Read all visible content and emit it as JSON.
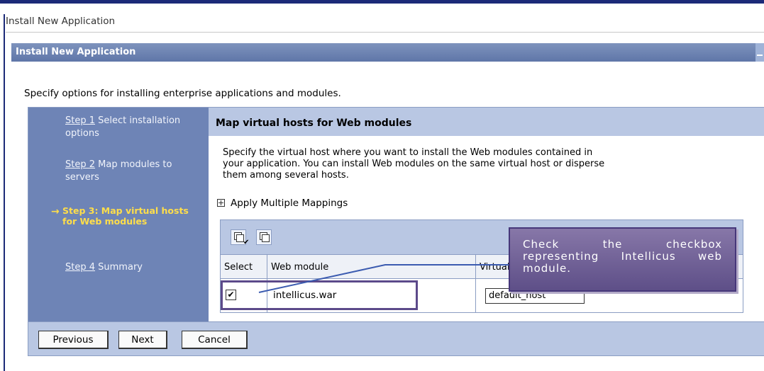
{
  "page": {
    "heading": "Install New Application"
  },
  "portlet": {
    "title": "Install New Application"
  },
  "intro": "Specify options for installing enterprise applications and modules.",
  "steps": [
    {
      "link": "Step 1",
      "text": "Select installation options"
    },
    {
      "link": "Step 2",
      "text": "Map modules to servers"
    },
    {
      "current": "Step 3: Map virtual hosts for Web modules"
    },
    {
      "link": "Step 4",
      "text": "Summary"
    }
  ],
  "content": {
    "title": "Map virtual hosts for Web modules",
    "description": "Specify the virtual host where you want to install the Web modules contained in your application. You can install Web modules on the same virtual host or disperse them among several hosts.",
    "expand_label": "Apply Multiple Mappings"
  },
  "table": {
    "columns": [
      "Select",
      "Web module",
      "Virtual host"
    ],
    "rows": [
      {
        "selected": "✔",
        "module": "intellicus.war",
        "virtual_host": "default_host"
      }
    ]
  },
  "buttons": {
    "previous": "Previous",
    "next": "Next",
    "cancel": "Cancel"
  },
  "callout": {
    "text": "Check the checkbox representing Intellicus web module."
  },
  "icons": {
    "arrow": "arrow-right-icon",
    "expand": "plus-box-icon",
    "select_all": "select-all-icon",
    "deselect_all": "deselect-all-icon"
  },
  "colors": {
    "accent": "#1c2a78",
    "nav": "#6e84b6",
    "current_step": "#ffde4a",
    "callout": "#6f5f98"
  }
}
